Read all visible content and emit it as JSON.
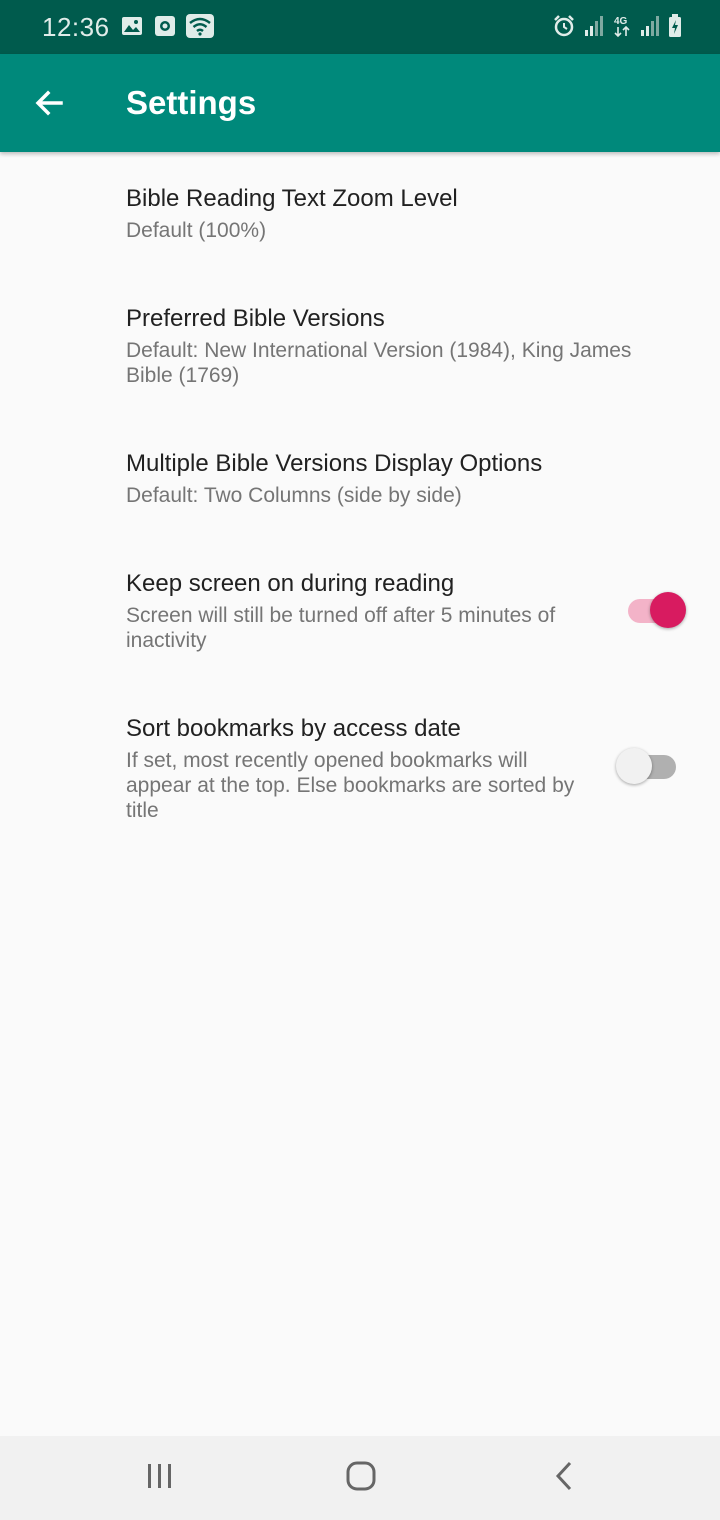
{
  "status_bar": {
    "time": "12:36",
    "left_icons": [
      "image-icon",
      "screen-record-icon",
      "wifi-icon"
    ],
    "right_icons": [
      "alarm-icon",
      "signal-icon",
      "4g-icon",
      "signal-icon",
      "battery-icon"
    ],
    "network_label": "4G"
  },
  "app_bar": {
    "title": "Settings",
    "back_icon": "arrow-left-icon",
    "background": "#00897b"
  },
  "settings": [
    {
      "title": "Bible Reading Text Zoom Level",
      "summary": "Default (100%)"
    },
    {
      "title": "Preferred Bible Versions",
      "summary": "Default: New International Version (1984), King James Bible (1769)"
    },
    {
      "title": "Multiple Bible Versions Display Options",
      "summary": "Default: Two Columns (side by side)"
    },
    {
      "title": "Keep screen on during reading",
      "summary": "Screen will still be turned off after 5 minutes of inactivity",
      "toggle_on": true
    },
    {
      "title": "Sort bookmarks by access date",
      "summary": "If set, most recently opened bookmarks will appear at the top. Else bookmarks are sorted by title",
      "toggle_on": false
    }
  ],
  "colors": {
    "accent": "#d81b60",
    "primary": "#00897b",
    "primary_dark": "#005b4d"
  },
  "nav_bar": {
    "buttons": [
      "recents-icon",
      "home-icon",
      "back-icon"
    ]
  }
}
